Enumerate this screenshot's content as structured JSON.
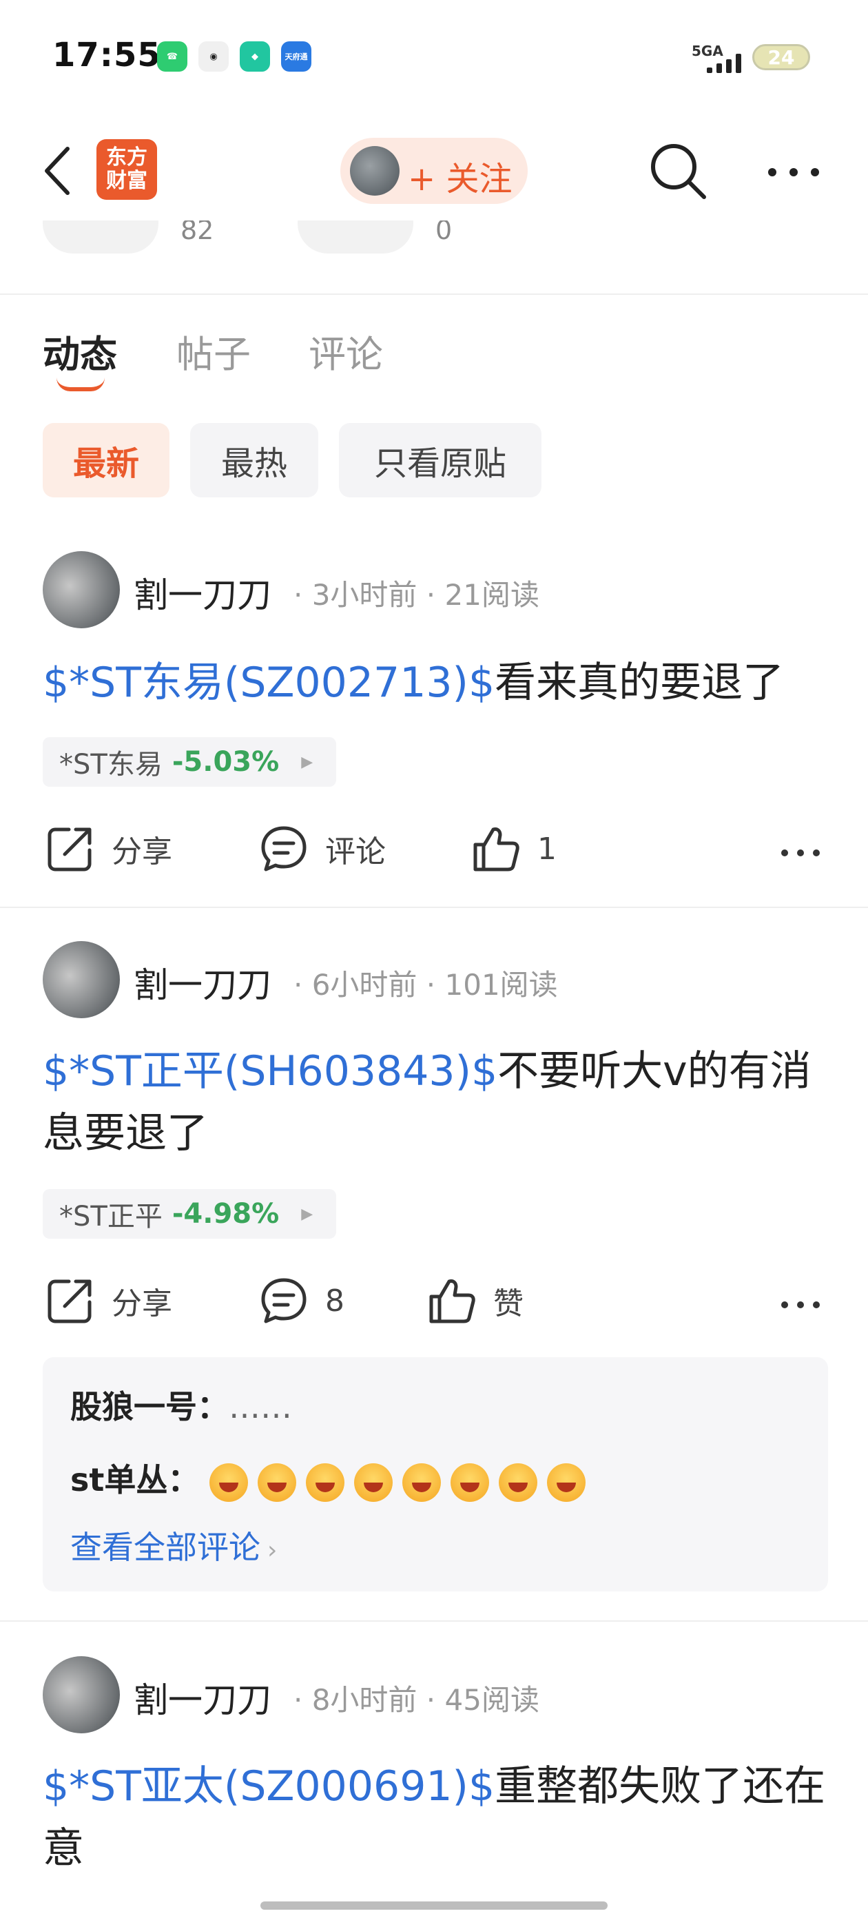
{
  "status_bar": {
    "time": "17:55",
    "network": "5GA",
    "battery": "24",
    "apps": [
      {
        "name": "phone-app-icon",
        "color": "#2ecc71",
        "label": "☎"
      },
      {
        "name": "camera-app-icon",
        "color": "#222222",
        "label": "◉"
      },
      {
        "name": "shield-app-icon",
        "color": "#21c6a0",
        "label": "◆"
      },
      {
        "name": "tiantian-app-icon",
        "color": "#2a7ae2",
        "label": "天府通"
      }
    ]
  },
  "header": {
    "logo_line1": "东方",
    "logo_line2": "财富",
    "follow_label": "+ 关注",
    "partial_counts": [
      "82",
      "0"
    ]
  },
  "tabs": [
    {
      "label": "动态",
      "active": true
    },
    {
      "label": "帖子",
      "active": false
    },
    {
      "label": "评论",
      "active": false
    }
  ],
  "filters": [
    {
      "label": "最新",
      "active": true
    },
    {
      "label": "最热",
      "active": false
    },
    {
      "label": "只看原贴",
      "active": false
    }
  ],
  "posts": [
    {
      "author": "割一刀刀",
      "time": "3小时前",
      "reads": "21阅读",
      "ticker": "$*ST东易(SZ002713)$",
      "text": "看来真的要退了",
      "stock_name": "*ST东易",
      "stock_change": "-5.03%",
      "share_label": "分享",
      "comment_label": "评论",
      "like_label": "1"
    },
    {
      "author": "割一刀刀",
      "time": "6小时前",
      "reads": "101阅读",
      "ticker": "$*ST正平(SH603843)$",
      "text": "不要听大v的有消息要退了",
      "stock_name": "*ST正平",
      "stock_change": "-4.98%",
      "share_label": "分享",
      "comment_label": "8",
      "like_label": "赞",
      "comments": [
        {
          "user": "股狼一号：",
          "content": "……"
        },
        {
          "user": "st单丛：",
          "content": ""
        }
      ],
      "view_all": "查看全部评论"
    },
    {
      "author": "割一刀刀",
      "time": "8小时前",
      "reads": "45阅读",
      "ticker": "$*ST亚太(SZ000691)$",
      "text": "重整都失败了还在意"
    }
  ],
  "colors": {
    "accent": "#ea5a2c",
    "link": "#2f6fd6",
    "down": "#3aa55b"
  }
}
